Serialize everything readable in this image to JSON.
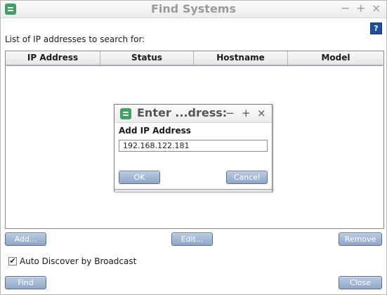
{
  "window": {
    "title": "Find Systems"
  },
  "controls": {
    "minimize": "−",
    "maximize": "+",
    "close": "×"
  },
  "help_label": "?",
  "search_label": "List of IP addresses to search for:",
  "table": {
    "columns": [
      "IP Address",
      "Status",
      "Hostname",
      "Model"
    ]
  },
  "buttons": {
    "add": "Add...",
    "edit": "Edit...",
    "remove": "Remove",
    "find": "Find",
    "close": "Close"
  },
  "auto_discover": {
    "label": "Auto Discover by Broadcast",
    "checked": true
  },
  "dialog": {
    "title": "Enter ...dress:",
    "field_label": "Add IP Address",
    "value": "192.168.122.181",
    "ok": "OK",
    "cancel": "Cancel"
  },
  "colors": {
    "app_icon": "#3fa164",
    "button": "#9fb5d3",
    "help": "#1f4fa3"
  }
}
